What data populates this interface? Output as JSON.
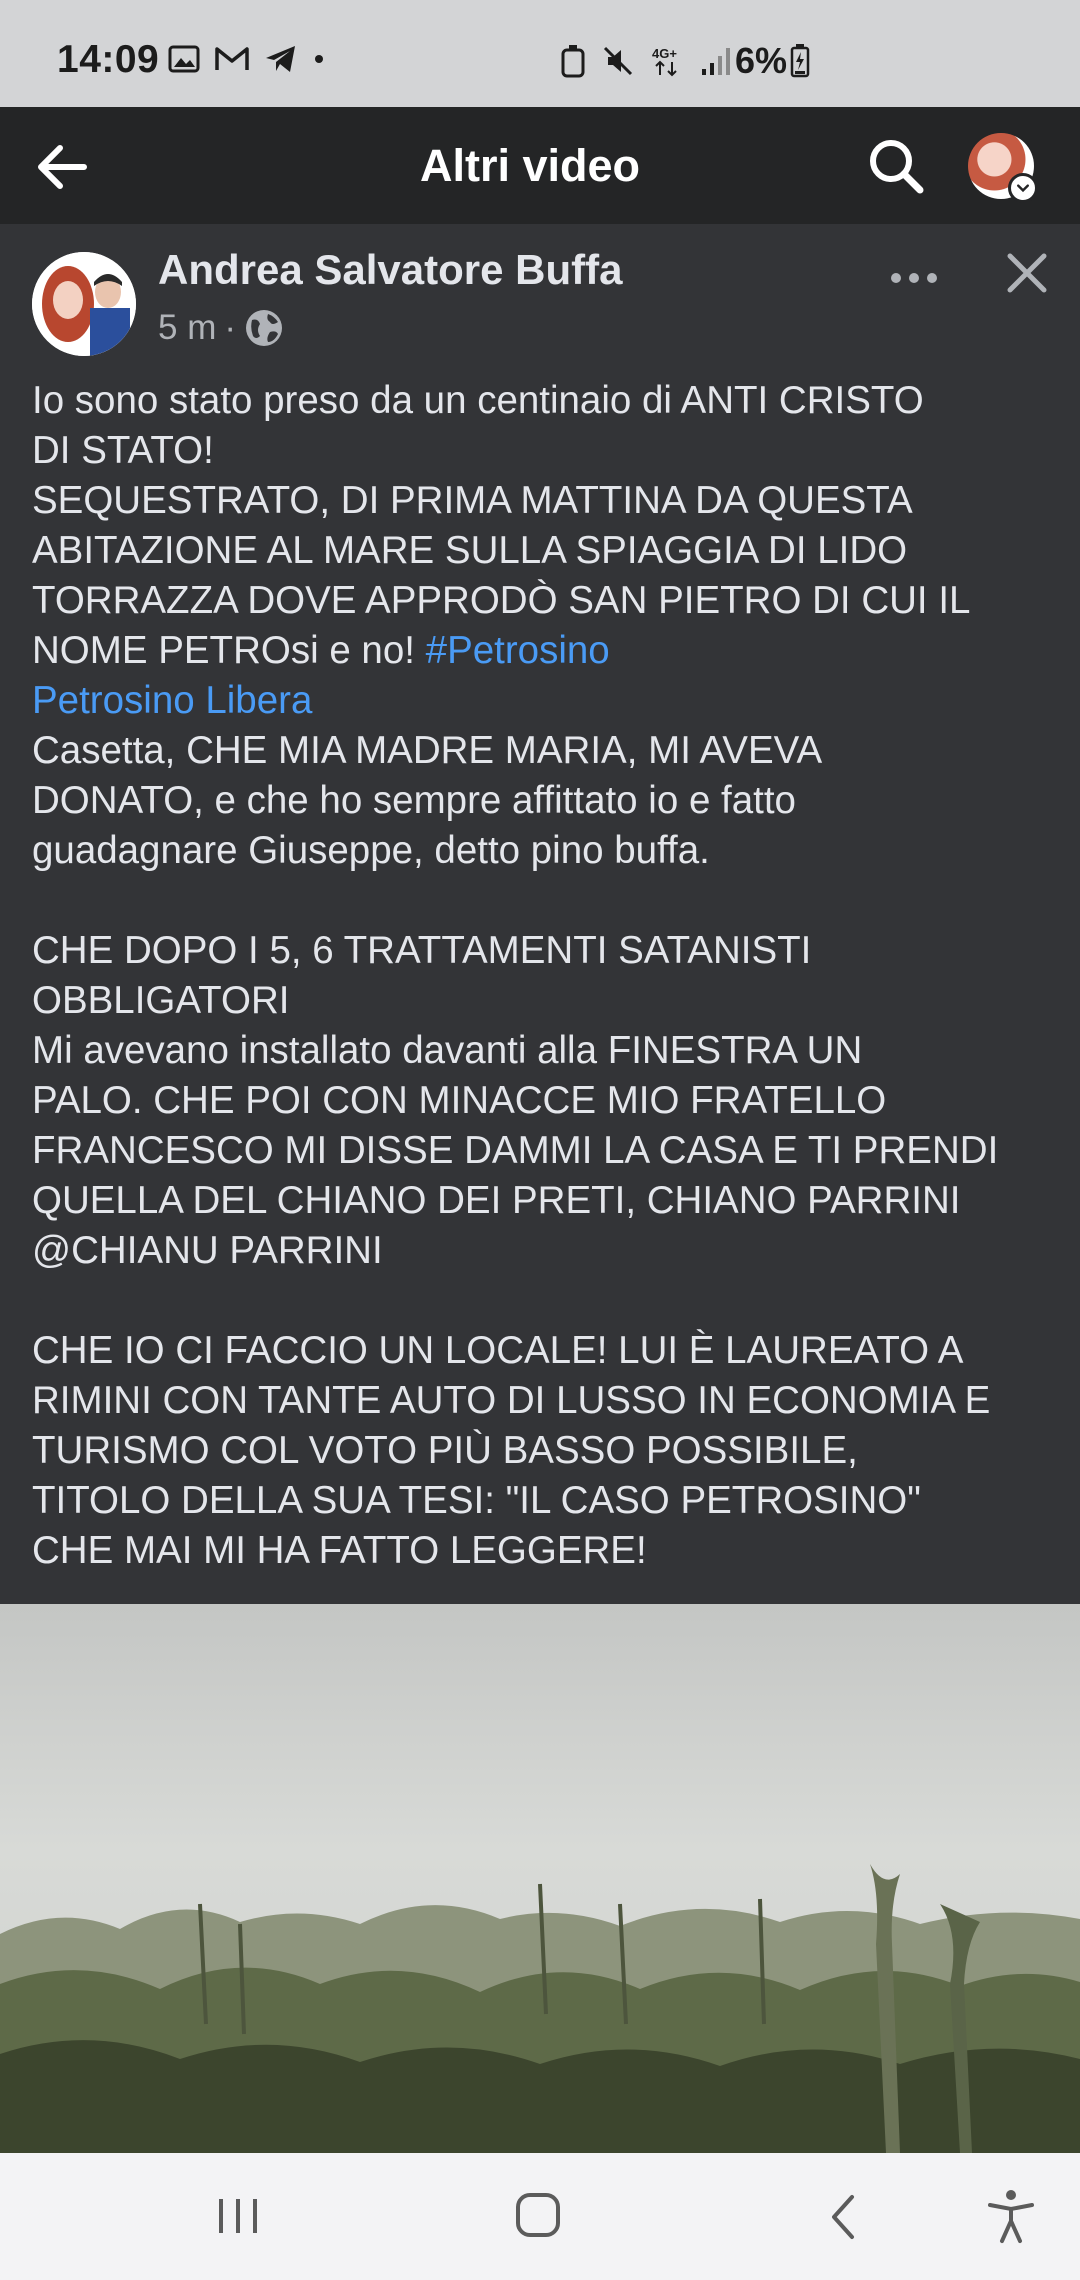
{
  "status_bar": {
    "time": "14:09",
    "left_icons": [
      "gallery-icon",
      "gmail-icon",
      "telegram-icon",
      "dot-icon"
    ],
    "right_icons": [
      "alarm-icon",
      "mute-icon",
      "4g-icon",
      "signal-icon"
    ],
    "battery_level": "6%"
  },
  "app_bar": {
    "title": "Altri video"
  },
  "post": {
    "author": "Andrea Salvatore Buffa",
    "time": "5 m",
    "separator": "·",
    "audience_icon": "globe-icon",
    "text_lines": [
      "Io sono stato preso da un centinaio di ANTI CRISTO",
      "DI STATO!",
      "SEQUESTRATO, DI PRIMA MATTINA DA QUESTA",
      "ABITAZIONE AL MARE SULLA SPIAGGIA DI LIDO",
      "TORRAZZA DOVE APPRODÒ SAN PIETRO DI CUI IL"
    ],
    "line6_text": "NOME PETROsi e no! ",
    "hashtag": "#Petrosino",
    "mention": "Petrosino Libera",
    "text_lines_2": [
      "Casetta, CHE MIA MADRE MARIA, MI AVEVA",
      "DONATO, e che ho sempre affittato io e fatto",
      "guadagnare Giuseppe, detto pino buffa."
    ],
    "text_lines_3": [
      "CHE DOPO I 5, 6 TRATTAMENTI SATANISTI",
      "OBBLIGATORI",
      "Mi avevano installato davanti alla FINESTRA UN",
      "PALO. CHE POI CON MINACCE MIO FRATELLO",
      "FRANCESCO MI DISSE DAMMI LA CASA E TI PRENDI",
      "QUELLA DEL CHIANO DEI PRETI, CHIANO PARRINI",
      "@CHIANU PARRINI"
    ],
    "text_lines_4": [
      "CHE IO CI FACCIO UN LOCALE! LUI È LAUREATO A",
      "RIMINI CON TANTE AUTO DI LUSSO IN ECONOMIA E",
      "TURISMO COL VOTO PIÙ BASSO POSSIBILE,",
      "TITOLO DELLA SUA TESI: \"IL CASO PETROSINO\"",
      "CHE MAI MI HA FATTO LEGGERE!"
    ]
  },
  "colors": {
    "background": "#242526",
    "post_bg": "#333437",
    "text": "#e4e6eb",
    "secondary_text": "#b0b3b8",
    "link": "#4a9bf5",
    "status_bar": "#d3d4d6",
    "nav_bar": "#f3f3f5"
  }
}
